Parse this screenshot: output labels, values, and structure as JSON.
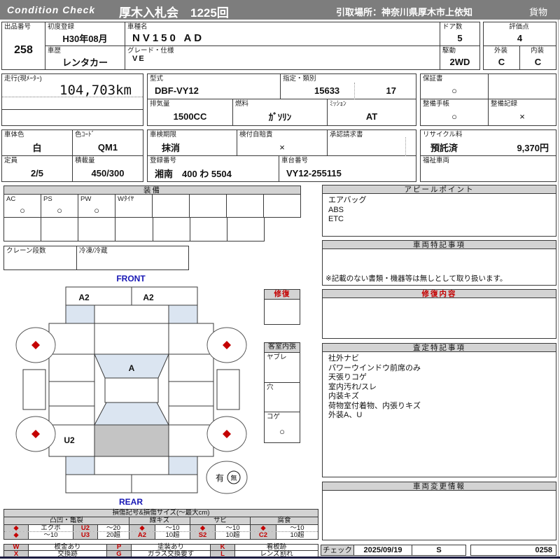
{
  "header": {
    "logo": "Condition  Check",
    "title": "厚木入札会　1225回",
    "pickup": "引取場所：神奈川県厚木市上依知",
    "category": "貨物"
  },
  "info": {
    "lot_label": "出品番号",
    "lot_no": "258",
    "first_reg_label": "初度登録",
    "first_reg": "H30年08月",
    "model_name_label": "車種名",
    "model_name": "NV150 AD",
    "doors_label": "ドア数",
    "doors": "5",
    "score_label": "評価点",
    "score": "4",
    "history_label": "車歴",
    "history": "レンタカー",
    "grade_label": "グレード・仕様",
    "grade": "VE",
    "drive_label": "駆動",
    "drive": "2WD",
    "exterior_label": "外装",
    "exterior": "C",
    "interior_label": "内装",
    "interior": "C",
    "mileage_label": "走行(現ﾒｰﾀｰ)",
    "mileage": "104,703km",
    "model_code_label": "型式",
    "model_code": "DBF-VY12",
    "class_label": "指定・類別",
    "class_no1": "15633",
    "class_no2": "17",
    "warranty_label": "保証書",
    "warranty": "○",
    "displacement_label": "排気量",
    "displacement": "1500CC",
    "fuel_label": "燃料",
    "fuel": "ｶﾞｿﾘﾝ",
    "mission_label": "ﾐｯｼｮﾝ",
    "mission": "AT",
    "maint_book_label": "整備手帳",
    "maint_book": "○",
    "maint_record_label": "整備記録",
    "maint_record": "×",
    "body_color_label": "車体色",
    "body_color": "白",
    "color_code_label": "色ｺｰﾄﾞ",
    "color_code": "QM1",
    "inspection_label": "車検期限",
    "inspection": "抹消",
    "insurance_label": "検付自賠責",
    "insurance": "×",
    "approval_label": "承認請求書",
    "recycle_label": "リサイクル料",
    "recycle_status": "預託済",
    "recycle_fee": "9,370円",
    "capacity_label": "定員",
    "capacity": "2/5",
    "load_label": "積載量",
    "load": "450/300",
    "reg_no_label": "登録番号",
    "reg_no": "湘南　400 わ 5504",
    "chassis_label": "車台番号",
    "chassis_no": "VY12-255115",
    "welfare_label": "福祉車両"
  },
  "equipment": {
    "title": "装備",
    "row1": [
      {
        "label": "AC",
        "value": "○"
      },
      {
        "label": "PS",
        "value": "○"
      },
      {
        "label": "PW",
        "value": "○"
      },
      {
        "label": "Wﾀｲﾔ",
        "value": ""
      },
      {
        "label": "",
        "value": ""
      },
      {
        "label": "",
        "value": ""
      },
      {
        "label": "",
        "value": ""
      },
      {
        "label": "",
        "value": ""
      }
    ],
    "crane_label": "クレーン段数",
    "fridge_label": "冷凍/冷蔵"
  },
  "repair_box": {
    "title": "修復"
  },
  "cabin_box": {
    "title": "客室内張",
    "items": [
      {
        "label": "ヤブレ",
        "value": ""
      },
      {
        "label": "穴",
        "value": ""
      },
      {
        "label": "コゲ",
        "value": "○"
      }
    ]
  },
  "diagram": {
    "front_label": "FRONT",
    "rear_label": "REAR",
    "bumper_front_left": "A2",
    "bumper_front_right": "A2",
    "windshield_mark": "A",
    "rear_left_mark": "U2",
    "wheel_mark": "◆",
    "spare_present": "有",
    "spare_absent": "無"
  },
  "panels": {
    "appeal": {
      "title": "アピールポイント",
      "lines": [
        "エアバッグ",
        "ABS",
        "ETC"
      ]
    },
    "vehicle_notes": {
      "title": "車両特記事項",
      "note": "※記載のない書類・機器等は無しとして取り扱います。"
    },
    "repair_details": {
      "title": "修復内容"
    },
    "assessment": {
      "title": "査定特記事項",
      "lines": [
        "社外ナビ",
        "パワーウインドウ前席のみ",
        "天張りコゲ",
        "室内汚れ/スレ",
        "内装キズ",
        "荷物室付着物、内張りキズ",
        "外装A、U"
      ]
    },
    "change_info": {
      "title": "車両変更情報"
    }
  },
  "legend": {
    "title": "損傷記号&損傷サイズ(～最大cm)",
    "group_names": [
      "凸凹・亀裂",
      "線キズ",
      "サビ",
      "腐食"
    ],
    "row1": [
      "◆",
      "エクボ",
      "U2",
      "～20",
      "◆",
      "～10",
      "◆",
      "～10",
      "◆",
      "～10"
    ],
    "row2": [
      "◆",
      "～10",
      "U3",
      "20超",
      "A2",
      "10超",
      "S2",
      "10超",
      "C2",
      "10超"
    ],
    "codes_row1": [
      {
        "code": "W",
        "desc": "板金あり"
      },
      {
        "code": "P",
        "desc": "塗装あり"
      },
      {
        "code": "K",
        "desc": "看板跡"
      }
    ],
    "codes_row2": [
      {
        "code": "X",
        "desc": "交換跡"
      },
      {
        "code": "G",
        "desc": "ガラス交換要す"
      },
      {
        "code": "L",
        "desc": "レンズ割れ"
      }
    ]
  },
  "check": {
    "label": "チェック",
    "date": "2025/09/19",
    "inspector": "S",
    "code": "0258"
  },
  "colors": {
    "bar_gray": "#7d7d7d",
    "header_gray": "#d3d3d3",
    "glass_blue": "#dbe5f1",
    "cargo_gray": "#c4c4c4",
    "mark_red": "#c40000",
    "label_blue": "#1717b5"
  }
}
